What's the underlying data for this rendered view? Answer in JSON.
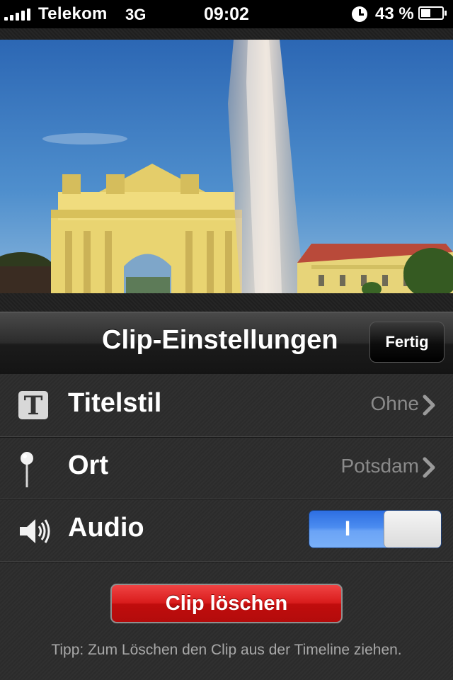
{
  "status_bar": {
    "carrier": "Telekom",
    "network": "3G",
    "time": "09:02",
    "battery_percent": "43 %",
    "signal_bars": 5,
    "battery_level": 0.43
  },
  "preview": {
    "description_icon": "video-preview-image"
  },
  "navbar": {
    "title": "Clip-Einstellungen",
    "done_label": "Fertig"
  },
  "settings": {
    "title_style": {
      "label": "Titelstil",
      "value": "Ohne",
      "icon": "text-t-icon"
    },
    "location": {
      "label": "Ort",
      "value": "Potsdam",
      "icon": "pin-icon"
    },
    "audio": {
      "label": "Audio",
      "toggle_on_label": "I",
      "enabled": true,
      "icon": "speaker-icon"
    }
  },
  "delete_button": "Clip löschen",
  "hint": "Tipp: Zum Löschen den Clip aus der Timeline ziehen.",
  "colors": {
    "accent_blue": "#4b8cf0",
    "delete_red": "#d91c1c",
    "secondary_text": "#8a8a8a"
  }
}
